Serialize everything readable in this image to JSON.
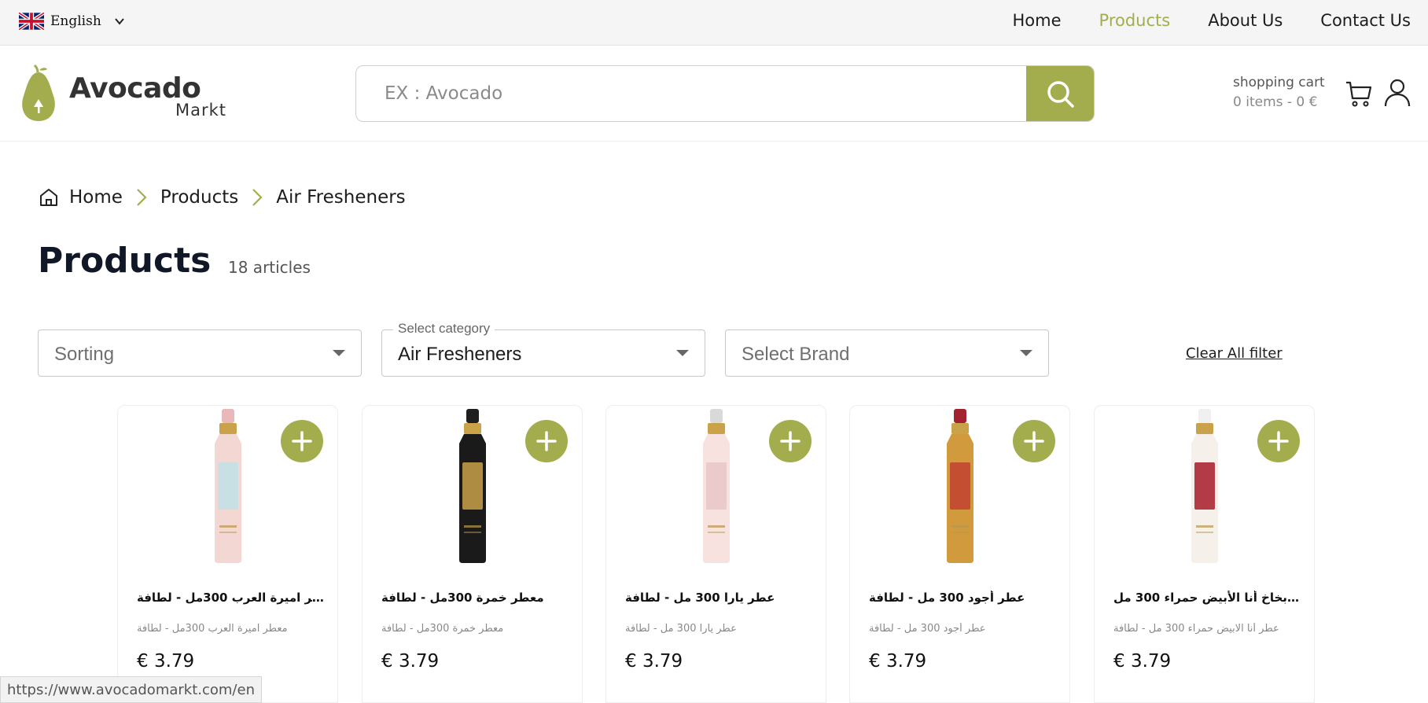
{
  "topbar": {
    "language": "English",
    "nav": [
      "Home",
      "Products",
      "About Us",
      "Contact Us"
    ],
    "active_nav": "Products"
  },
  "header": {
    "logo_name": "Avocado",
    "logo_sub": "Markt",
    "search_placeholder": "EX : Avocado",
    "cart_title": "shopping cart",
    "cart_summary": "0 items - 0 €"
  },
  "breadcrumb": [
    "Home",
    "Products",
    "Air Fresheners"
  ],
  "page": {
    "title": "Products",
    "count": "18 articles"
  },
  "filters": {
    "sorting_placeholder": "Sorting",
    "category_label": "Select category",
    "category_value": "Air Fresheners",
    "brand_placeholder": "Select Brand",
    "clear_label": "Clear All filter"
  },
  "products": [
    {
      "name": "معطر اميرة العرب 300مل - لطافة",
      "desc": "معطر اميرة العرب 300مل - لطافة",
      "price": "€ 3.79",
      "cap_color": "#e9b8b8",
      "body_color": "#f3d7d3",
      "label_color": "#bfe0e5"
    },
    {
      "name": "معطر خمرة 300مل - لطافة",
      "desc": "معطر خمرة 300مل - لطافة",
      "price": "€ 3.79",
      "cap_color": "#1f1f1f",
      "body_color": "#1a1a1a",
      "label_color": "#c9a24a"
    },
    {
      "name": "عطر يارا 300 مل - لطافة",
      "desc": "عطر يارا 300 مل - لطافة",
      "price": "€ 3.79",
      "cap_color": "#d9d9d9",
      "body_color": "#f7e2e0",
      "label_color": "#e9c6c8"
    },
    {
      "name": "عطر أجود 300 مل - لطافة",
      "desc": "عطر أجود 300 مل - لطافة",
      "price": "€ 3.79",
      "cap_color": "#a3222f",
      "body_color": "#d09a3d",
      "label_color": "#c2412f"
    },
    {
      "name": "عطر بخاخ أنا الأبيض حمراء 300 مل...",
      "desc": "عطر أنا الابيض حمراء 300 مل - لطافة",
      "price": "€ 3.79",
      "cap_color": "#f0f0f0",
      "body_color": "#f5f1ea",
      "label_color": "#a61b2a"
    }
  ],
  "status_url": "https://www.avocadomarkt.com/en",
  "colors": {
    "accent": "#a4ad4e"
  }
}
